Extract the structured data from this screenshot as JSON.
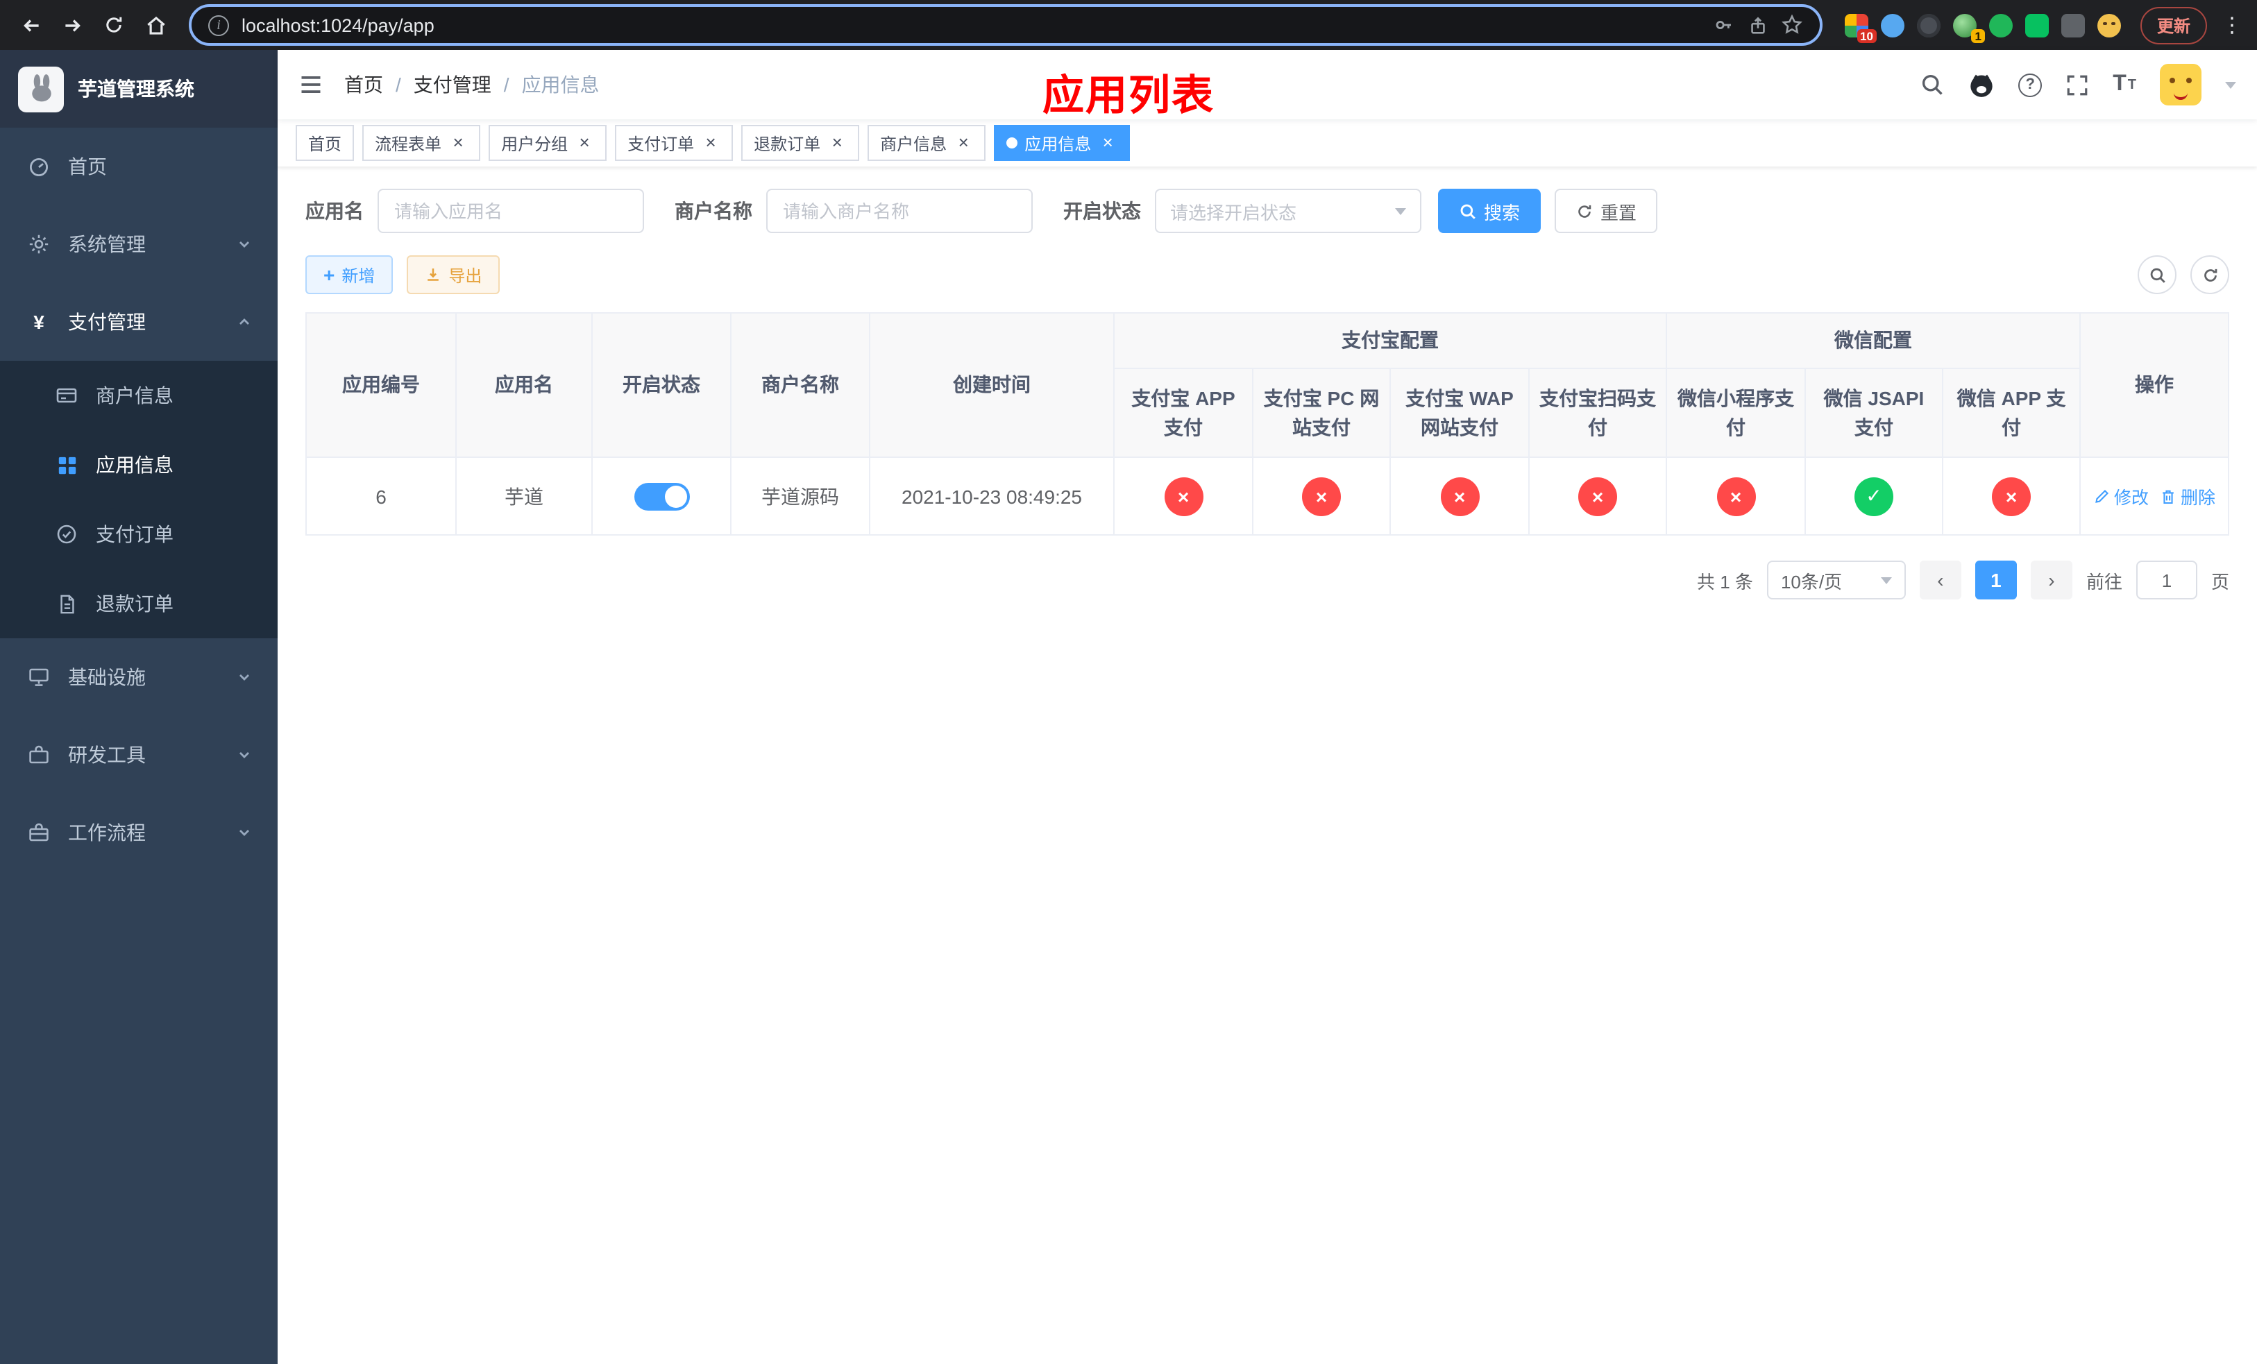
{
  "browser": {
    "url": "localhost:1024/pay/app",
    "update_label": "更新",
    "ext_badge_count": "10",
    "profile_badge_count": "1"
  },
  "icons": {
    "info": "i",
    "yen": "¥",
    "question": "?",
    "close": "×",
    "check": "✓",
    "cross": "×",
    "plus": "+",
    "kebab": "⋮",
    "prev": "‹",
    "next": "›",
    "font_large": "T",
    "font_small": "T"
  },
  "sidebar": {
    "title": "芋道管理系统",
    "menu_home": "首页",
    "menu_system": "系统管理",
    "menu_pay": "支付管理",
    "menu_infra": "基础设施",
    "menu_dev": "研发工具",
    "menu_flow": "工作流程",
    "submenu": [
      {
        "label": "商户信息"
      },
      {
        "label": "应用信息"
      },
      {
        "label": "支付订单"
      },
      {
        "label": "退款订单"
      }
    ]
  },
  "navbar": {
    "breadcrumb": [
      {
        "label": "首页"
      },
      {
        "label": "支付管理"
      },
      {
        "label": "应用信息"
      }
    ],
    "separator": "/",
    "page_title": "应用列表"
  },
  "tabs": [
    {
      "label": "首页",
      "closable": false,
      "active": false
    },
    {
      "label": "流程表单",
      "closable": true,
      "active": false
    },
    {
      "label": "用户分组",
      "closable": true,
      "active": false
    },
    {
      "label": "支付订单",
      "closable": true,
      "active": false
    },
    {
      "label": "退款订单",
      "closable": true,
      "active": false
    },
    {
      "label": "商户信息",
      "closable": true,
      "active": false
    },
    {
      "label": "应用信息",
      "closable": true,
      "active": true
    }
  ],
  "filters": {
    "app_name_label": "应用名",
    "app_name_placeholder": "请输入应用名",
    "merchant_label": "商户名称",
    "merchant_placeholder": "请输入商户名称",
    "status_label": "开启状态",
    "status_placeholder": "请选择开启状态",
    "search_label": "搜索",
    "reset_label": "重置"
  },
  "toolbar": {
    "add_label": "新增",
    "export_label": "导出"
  },
  "table": {
    "headers": {
      "app_id": "应用编号",
      "app_name": "应用名",
      "status": "开启状态",
      "merchant": "商户名称",
      "create_time": "创建时间",
      "alipay_group": "支付宝配置",
      "wechat_group": "微信配置",
      "actions": "操作",
      "channels": [
        "支付宝 APP 支付",
        "支付宝 PC 网站支付",
        "支付宝 WAP 网站支付",
        "支付宝扫码支付",
        "微信小程序支付",
        "微信 JSAPI 支付",
        "微信 APP 支付"
      ]
    },
    "row": {
      "app_id": "6",
      "app_name": "芋道",
      "status_on": true,
      "merchant": "芋道源码",
      "create_time": "2021-10-23 08:49:25",
      "channels": [
        "no",
        "no",
        "no",
        "no",
        "no",
        "yes",
        "no"
      ],
      "edit_label": "修改",
      "delete_label": "删除"
    }
  },
  "pagination": {
    "total_label": "共 1 条",
    "page_size": "10条/页",
    "current_page": "1",
    "goto_label": "前往",
    "goto_value": "1",
    "page_unit": "页"
  },
  "colors": {
    "primary": "#409eff",
    "success": "#13ce66",
    "danger": "#ff4949",
    "page_title_red": "#ff0000",
    "sidebar_bg": "#304156",
    "submenu_bg": "#1f2d3d"
  }
}
